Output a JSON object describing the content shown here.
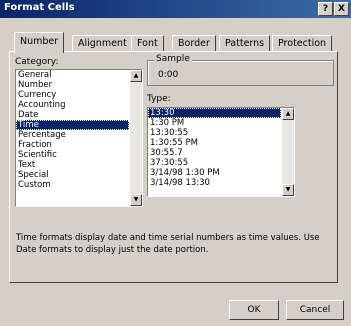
{
  "window": {
    "title": "Format Cells",
    "help_label": "?",
    "close_label": "X"
  },
  "tabs": [
    {
      "label": "Number",
      "active": true
    },
    {
      "label": "Alignment"
    },
    {
      "label": "Font"
    },
    {
      "label": "Border"
    },
    {
      "label": "Patterns"
    },
    {
      "label": "Protection"
    }
  ],
  "category": {
    "label": "Category:",
    "items": [
      "General",
      "Number",
      "Currency",
      "Accounting",
      "Date",
      "Time",
      "Percentage",
      "Fraction",
      "Scientific",
      "Text",
      "Special",
      "Custom"
    ],
    "selected": "Time"
  },
  "sample": {
    "label": "Sample",
    "value": "0:00"
  },
  "type": {
    "label": "Type:",
    "items": [
      "13:30",
      "1:30 PM",
      "13:30:55",
      "1:30:55 PM",
      "30:55.7",
      "37:30:55",
      "3/14/98 1:30 PM",
      "3/14/98 13:30"
    ],
    "selected": "13:30"
  },
  "description": "Time formats display date and time serial numbers as time values.  Use Date formats to display just the date portion.",
  "buttons": {
    "ok": "OK",
    "cancel": "Cancel"
  },
  "icons": {
    "scroll_up": "up-arrow",
    "scroll_down": "down-arrow"
  },
  "colors": {
    "titlebar": "#0a246a",
    "face": "#d4d0c8",
    "selection": "#0a246a"
  }
}
